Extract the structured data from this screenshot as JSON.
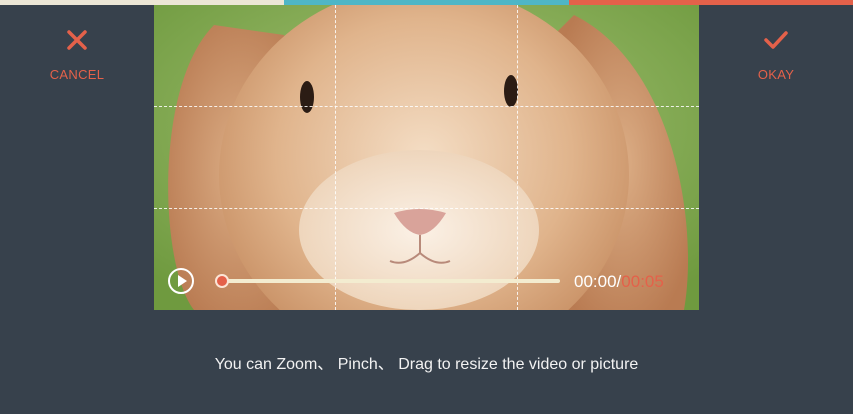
{
  "colors": {
    "background": "#37414c",
    "accent": "#e4614a",
    "strip": [
      "#ece6d6",
      "#4fb6c6",
      "#e4614a"
    ],
    "text": "#f2f2f2"
  },
  "actions": {
    "cancel": {
      "label": "CANCEL",
      "icon": "close-icon"
    },
    "okay": {
      "label": "OKAY",
      "icon": "check-icon"
    }
  },
  "player": {
    "current_time": "00:00",
    "separator": "/",
    "total_time": "00:05",
    "progress": 0.0,
    "play_icon": "play-icon"
  },
  "hint": "You can Zoom、 Pinch、 Drag to resize the video or picture"
}
